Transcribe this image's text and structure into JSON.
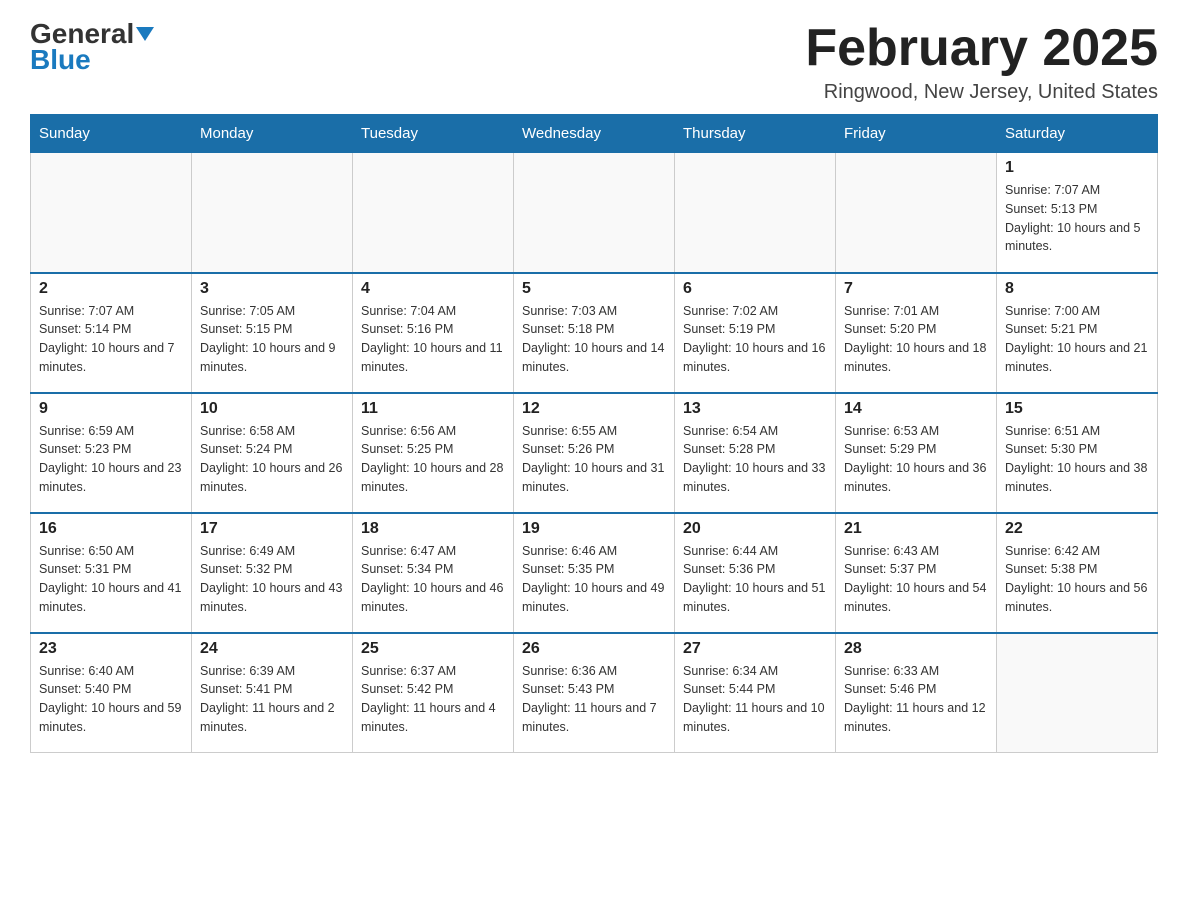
{
  "header": {
    "logo_general": "General",
    "logo_blue": "Blue",
    "month_title": "February 2025",
    "location": "Ringwood, New Jersey, United States"
  },
  "days_of_week": [
    "Sunday",
    "Monday",
    "Tuesday",
    "Wednesday",
    "Thursday",
    "Friday",
    "Saturday"
  ],
  "weeks": [
    [
      {
        "day": "",
        "info": ""
      },
      {
        "day": "",
        "info": ""
      },
      {
        "day": "",
        "info": ""
      },
      {
        "day": "",
        "info": ""
      },
      {
        "day": "",
        "info": ""
      },
      {
        "day": "",
        "info": ""
      },
      {
        "day": "1",
        "info": "Sunrise: 7:07 AM\nSunset: 5:13 PM\nDaylight: 10 hours and 5 minutes."
      }
    ],
    [
      {
        "day": "2",
        "info": "Sunrise: 7:07 AM\nSunset: 5:14 PM\nDaylight: 10 hours and 7 minutes."
      },
      {
        "day": "3",
        "info": "Sunrise: 7:05 AM\nSunset: 5:15 PM\nDaylight: 10 hours and 9 minutes."
      },
      {
        "day": "4",
        "info": "Sunrise: 7:04 AM\nSunset: 5:16 PM\nDaylight: 10 hours and 11 minutes."
      },
      {
        "day": "5",
        "info": "Sunrise: 7:03 AM\nSunset: 5:18 PM\nDaylight: 10 hours and 14 minutes."
      },
      {
        "day": "6",
        "info": "Sunrise: 7:02 AM\nSunset: 5:19 PM\nDaylight: 10 hours and 16 minutes."
      },
      {
        "day": "7",
        "info": "Sunrise: 7:01 AM\nSunset: 5:20 PM\nDaylight: 10 hours and 18 minutes."
      },
      {
        "day": "8",
        "info": "Sunrise: 7:00 AM\nSunset: 5:21 PM\nDaylight: 10 hours and 21 minutes."
      }
    ],
    [
      {
        "day": "9",
        "info": "Sunrise: 6:59 AM\nSunset: 5:23 PM\nDaylight: 10 hours and 23 minutes."
      },
      {
        "day": "10",
        "info": "Sunrise: 6:58 AM\nSunset: 5:24 PM\nDaylight: 10 hours and 26 minutes."
      },
      {
        "day": "11",
        "info": "Sunrise: 6:56 AM\nSunset: 5:25 PM\nDaylight: 10 hours and 28 minutes."
      },
      {
        "day": "12",
        "info": "Sunrise: 6:55 AM\nSunset: 5:26 PM\nDaylight: 10 hours and 31 minutes."
      },
      {
        "day": "13",
        "info": "Sunrise: 6:54 AM\nSunset: 5:28 PM\nDaylight: 10 hours and 33 minutes."
      },
      {
        "day": "14",
        "info": "Sunrise: 6:53 AM\nSunset: 5:29 PM\nDaylight: 10 hours and 36 minutes."
      },
      {
        "day": "15",
        "info": "Sunrise: 6:51 AM\nSunset: 5:30 PM\nDaylight: 10 hours and 38 minutes."
      }
    ],
    [
      {
        "day": "16",
        "info": "Sunrise: 6:50 AM\nSunset: 5:31 PM\nDaylight: 10 hours and 41 minutes."
      },
      {
        "day": "17",
        "info": "Sunrise: 6:49 AM\nSunset: 5:32 PM\nDaylight: 10 hours and 43 minutes."
      },
      {
        "day": "18",
        "info": "Sunrise: 6:47 AM\nSunset: 5:34 PM\nDaylight: 10 hours and 46 minutes."
      },
      {
        "day": "19",
        "info": "Sunrise: 6:46 AM\nSunset: 5:35 PM\nDaylight: 10 hours and 49 minutes."
      },
      {
        "day": "20",
        "info": "Sunrise: 6:44 AM\nSunset: 5:36 PM\nDaylight: 10 hours and 51 minutes."
      },
      {
        "day": "21",
        "info": "Sunrise: 6:43 AM\nSunset: 5:37 PM\nDaylight: 10 hours and 54 minutes."
      },
      {
        "day": "22",
        "info": "Sunrise: 6:42 AM\nSunset: 5:38 PM\nDaylight: 10 hours and 56 minutes."
      }
    ],
    [
      {
        "day": "23",
        "info": "Sunrise: 6:40 AM\nSunset: 5:40 PM\nDaylight: 10 hours and 59 minutes."
      },
      {
        "day": "24",
        "info": "Sunrise: 6:39 AM\nSunset: 5:41 PM\nDaylight: 11 hours and 2 minutes."
      },
      {
        "day": "25",
        "info": "Sunrise: 6:37 AM\nSunset: 5:42 PM\nDaylight: 11 hours and 4 minutes."
      },
      {
        "day": "26",
        "info": "Sunrise: 6:36 AM\nSunset: 5:43 PM\nDaylight: 11 hours and 7 minutes."
      },
      {
        "day": "27",
        "info": "Sunrise: 6:34 AM\nSunset: 5:44 PM\nDaylight: 11 hours and 10 minutes."
      },
      {
        "day": "28",
        "info": "Sunrise: 6:33 AM\nSunset: 5:46 PM\nDaylight: 11 hours and 12 minutes."
      },
      {
        "day": "",
        "info": ""
      }
    ]
  ]
}
